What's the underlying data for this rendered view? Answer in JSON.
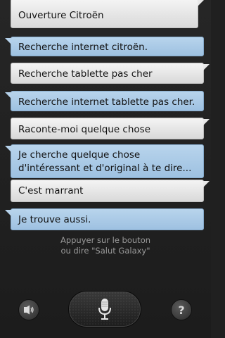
{
  "conversation": [
    {
      "role": "user",
      "text": "Ouverture Citroën"
    },
    {
      "role": "assistant",
      "text": "Recherche internet citroën."
    },
    {
      "role": "user",
      "text": "Recherche tablette pas cher"
    },
    {
      "role": "assistant",
      "text": "Recherche internet tablette pas cher."
    },
    {
      "role": "user",
      "text": "Raconte-moi quelque chose"
    },
    {
      "role": "assistant",
      "text": "Je cherche quelque chose d'intéressant et d'original à te dire..."
    },
    {
      "role": "user",
      "text": "C'est marrant"
    },
    {
      "role": "assistant",
      "text": "Je trouve aussi."
    }
  ],
  "prompt": {
    "line1": "Appuyer sur le bouton",
    "line2": "ou dire \"Salut Galaxy\""
  },
  "controls": {
    "left_icon": "speaker-icon",
    "center_icon": "microphone-icon",
    "right_label": "?"
  },
  "colors": {
    "background": "#202020",
    "user_bubble": "#e8e8e8",
    "assistant_bubble": "#a9c9e6",
    "prompt_text": "#9a9a9a"
  }
}
